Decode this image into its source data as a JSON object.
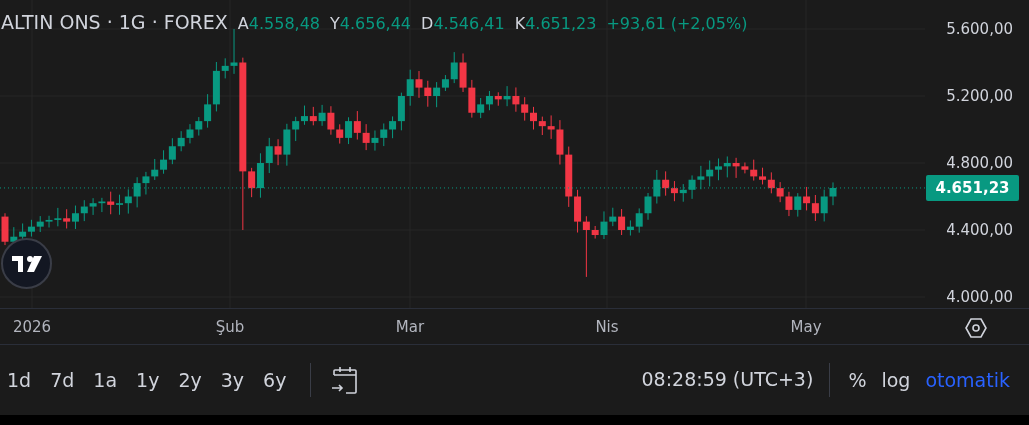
{
  "legend": {
    "symbol": "ALTIN ONS · 1G · FOREX",
    "values": [
      {
        "label": "A",
        "value": "4.558,48"
      },
      {
        "label": "Y",
        "value": "4.656,44"
      },
      {
        "label": "D",
        "value": "4.546,41"
      },
      {
        "label": "K",
        "value": "4.651,23"
      }
    ],
    "change": "+93,61 (+2,05%)"
  },
  "price_axis": {
    "ticks": [
      "5.600,00",
      "5.200,00",
      "4.800,00",
      "4.400,00",
      "4.000,00"
    ],
    "last_price": "4.651,23"
  },
  "time_axis": {
    "labels": [
      "2026",
      "Şub",
      "Mar",
      "Nis",
      "May"
    ]
  },
  "range_buttons": [
    "1d",
    "7d",
    "1a",
    "1y",
    "2y",
    "3y",
    "6y"
  ],
  "clock": "08:28:59 (UTC+3)",
  "scale_buttons": [
    {
      "label": "%",
      "selected": false
    },
    {
      "label": "log",
      "selected": false
    },
    {
      "label": "otomatik",
      "selected": true
    }
  ]
}
